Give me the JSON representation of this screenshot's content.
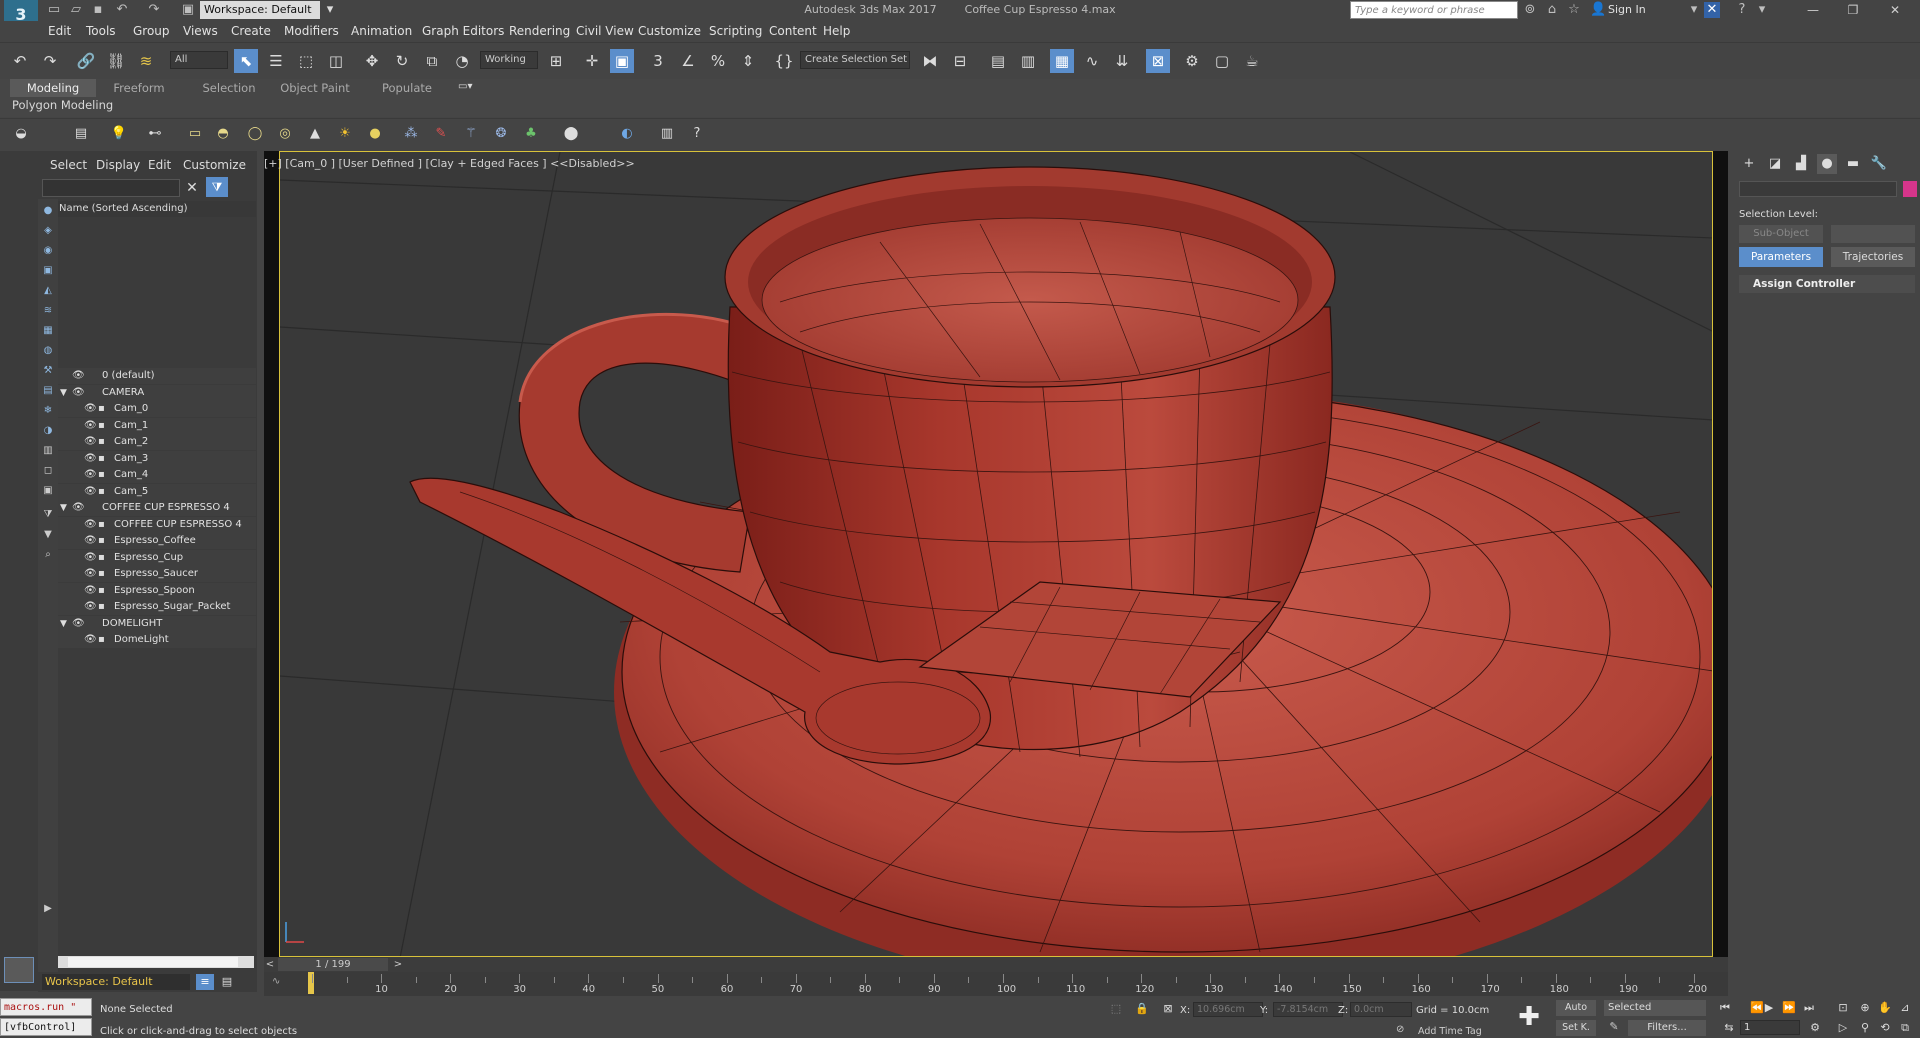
{
  "title_bar": {
    "app_logo": "3",
    "workspace_select": "Workspace: Default",
    "app_name": "Autodesk 3ds Max 2017",
    "file_name": "Coffee Cup Espresso 4.max",
    "search_placeholder": "Type a keyword or phrase",
    "sign_in": "Sign In"
  },
  "menu": [
    "Edit",
    "Tools",
    "Group",
    "Views",
    "Create",
    "Modifiers",
    "Animation",
    "Graph Editors",
    "Rendering",
    "Civil View",
    "Customize",
    "Scripting",
    "Content",
    "Help"
  ],
  "main_toolbar": {
    "selection_filter": "All",
    "coord_system": "Working",
    "selection_set": "Create Selection Set"
  },
  "ribbon": {
    "tabs": [
      "Modeling",
      "Freeform",
      "Selection",
      "Object Paint",
      "Populate"
    ],
    "active_tab": "Modeling",
    "panel_label": "Polygon Modeling"
  },
  "explorer": {
    "menu": [
      "Select",
      "Display",
      "Edit",
      "Customize"
    ],
    "column_header": "Name (Sorted Ascending)",
    "rows": [
      {
        "label": "0 (default)",
        "level": 0,
        "expander": false
      },
      {
        "label": "CAMERA",
        "level": 0,
        "expander": true
      },
      {
        "label": "Cam_0",
        "level": 1,
        "expander": false
      },
      {
        "label": "Cam_1",
        "level": 1,
        "expander": false
      },
      {
        "label": "Cam_2",
        "level": 1,
        "expander": false
      },
      {
        "label": "Cam_3",
        "level": 1,
        "expander": false
      },
      {
        "label": "Cam_4",
        "level": 1,
        "expander": false
      },
      {
        "label": "Cam_5",
        "level": 1,
        "expander": false
      },
      {
        "label": "COFFEE CUP ESPRESSO 4",
        "level": 0,
        "expander": true
      },
      {
        "label": "COFFEE CUP ESPRESSO 4",
        "level": 1,
        "expander": false
      },
      {
        "label": "Espresso_Coffee",
        "level": 1,
        "expander": false
      },
      {
        "label": "Espresso_Cup",
        "level": 1,
        "expander": false
      },
      {
        "label": "Espresso_Saucer",
        "level": 1,
        "expander": false
      },
      {
        "label": "Espresso_Spoon",
        "level": 1,
        "expander": false
      },
      {
        "label": "Espresso_Sugar_Packet",
        "level": 1,
        "expander": false
      },
      {
        "label": "DOMELIGHT",
        "level": 0,
        "expander": true
      },
      {
        "label": "DomeLight",
        "level": 1,
        "expander": false
      }
    ],
    "workspace_label": "Workspace: Default"
  },
  "viewport": {
    "label": "[+] [Cam_0 ] [User Defined ] [Clay + Edged Faces ]  <<Disabled>>",
    "clay_color": "#b84a40",
    "border_color": "#d8c23a"
  },
  "command_panel": {
    "selection_level": "Selection Level:",
    "sub_object": "Sub-Object",
    "parameters": "Parameters",
    "trajectories": "Trajectories",
    "assign_controller": "Assign Controller",
    "object_color": "#d6358b"
  },
  "timeline": {
    "frame_label": "1 / 199",
    "ticks": [
      "10",
      "20",
      "30",
      "40",
      "50",
      "60",
      "70",
      "80",
      "90",
      "100",
      "110",
      "120",
      "130",
      "140",
      "150",
      "160",
      "170",
      "180",
      "190",
      "200"
    ]
  },
  "status_bar": {
    "maxscript_line1": "macros.run \"",
    "maxscript_line2": "[vfbControl]",
    "selection_status": "None Selected",
    "prompt": "Click or click-and-drag to select objects",
    "x_label": "X:",
    "x_value": "10.696cm",
    "y_label": "Y:",
    "y_value": "-7.8154cm",
    "z_label": "Z:",
    "z_value": "0.0cm",
    "grid": "Grid = 10.0cm",
    "add_time_tag": "Add Time Tag",
    "auto_key": "Auto",
    "set_key": "Set K.",
    "key_mode": "Selected",
    "filters": "Filters...",
    "current_frame": "1"
  }
}
